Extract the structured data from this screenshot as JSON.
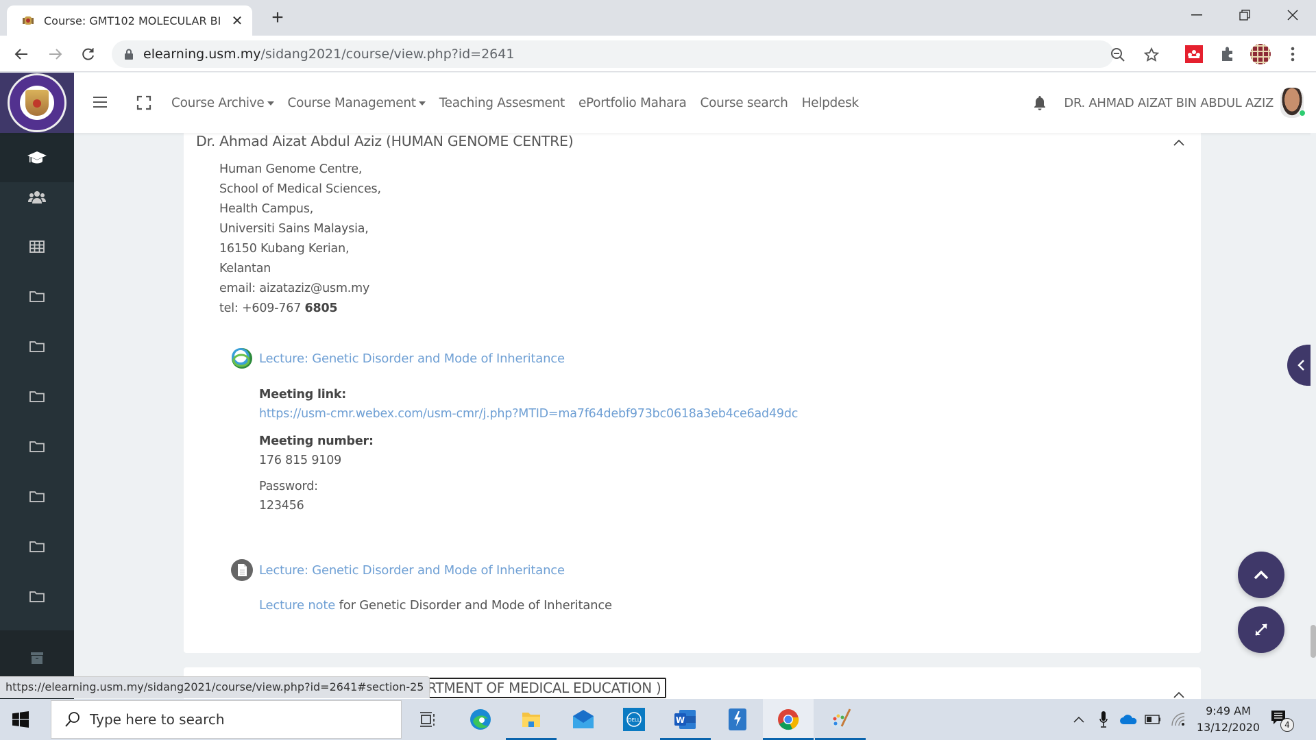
{
  "browser": {
    "tab_title": "Course: GMT102 MOLECULAR BI",
    "url_host": "elearning.usm.my",
    "url_path": "/sidang2021/course/view.php?id=2641",
    "status_url": "https://elearning.usm.my/sidang2021/course/view.php?id=2641#section-25"
  },
  "navbar": {
    "items": [
      {
        "label": "Course Archive",
        "dropdown": true
      },
      {
        "label": "Course Management",
        "dropdown": true
      },
      {
        "label": "Teaching Assesment",
        "dropdown": false
      },
      {
        "label": "ePortfolio Mahara",
        "dropdown": false
      },
      {
        "label": "Course search",
        "dropdown": false
      },
      {
        "label": "Helpdesk",
        "dropdown": false
      }
    ],
    "user_name": "DR. AHMAD AIZAT BIN ABDUL AZIZ"
  },
  "sidebar": {
    "items": [
      {
        "icon": "graduation-cap-icon"
      },
      {
        "icon": "users-icon"
      },
      {
        "icon": "grades-table-icon"
      },
      {
        "icon": "folder-icon"
      },
      {
        "icon": "folder-icon"
      },
      {
        "icon": "folder-icon"
      },
      {
        "icon": "folder-icon"
      },
      {
        "icon": "folder-icon"
      },
      {
        "icon": "folder-icon"
      },
      {
        "icon": "folder-icon"
      }
    ],
    "bottom_icon": "archive-icon"
  },
  "section": {
    "title": "Dr. Ahmad Aizat Abdul Aziz (HUMAN GENOME CENTRE)",
    "address_lines": [
      "Human Genome Centre,",
      "School of Medical Sciences,",
      "Health Campus,",
      "Universiti Sains Malaysia,",
      "16150 Kubang Kerian,",
      "Kelantan",
      "email: aizataziz@usm.my"
    ],
    "tel_prefix": "tel: +609-767 ",
    "tel_bold": "6805",
    "activities": [
      {
        "type": "webex",
        "title": "Lecture: Genetic Disorder and Mode of Inheritance"
      },
      {
        "type": "file",
        "title": "Lecture: Genetic Disorder and Mode of Inheritance"
      }
    ],
    "meeting": {
      "link_label": "Meeting link:",
      "link": "https://usm-cmr.webex.com/usm-cmr/j.php?MTID=ma7f64debf973bc0618a3eb4ce6ad49dc",
      "number_label": "Meeting number:",
      "number": "176 815 9109",
      "password_label": "Password:",
      "password": "123456"
    },
    "note_link": "Lecture note",
    "note_text": " for Genetic Disorder and Mode of Inheritance"
  },
  "next_section": {
    "title_visible": "ARTMENT OF MEDICAL EDUCATION )"
  },
  "taskbar": {
    "search_placeholder": "Type here to search",
    "time": "9:49 AM",
    "date": "13/12/2020",
    "notification_count": "4",
    "apps": [
      "task-view",
      "edge",
      "file-explorer",
      "mail",
      "dell",
      "word",
      "azure-data-studio",
      "chrome",
      "paint"
    ]
  },
  "colors": {
    "brand": "#3f3869",
    "sidebar": "#263238",
    "link": "#6e9fd4",
    "page_bg": "#eef1f3"
  }
}
